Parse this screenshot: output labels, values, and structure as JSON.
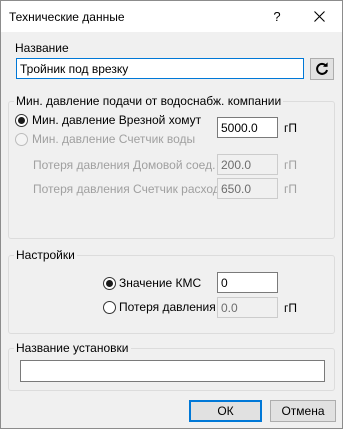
{
  "window": {
    "title": "Технические данные",
    "help_label": "?"
  },
  "name_section": {
    "label": "Название",
    "value": "Тройник под врезку"
  },
  "pressure_group": {
    "title": "Мин. давление подачи от водоснабж. компании",
    "option1_label": "Мин. давление Врезной хомут",
    "option1_value": "5000.0",
    "option1_unit": "гП",
    "option2_label": "Мин. давление Счетчик воды",
    "loss_home_label": "Потеря давления Домовой соед.",
    "loss_home_value": "200.0",
    "loss_home_unit": "гП",
    "loss_meter_label": "Потеря давления Счетчик расхода",
    "loss_meter_value": "650.0",
    "loss_meter_unit": "гП"
  },
  "settings_group": {
    "title": "Настройки",
    "kms_label": "Значение КМС",
    "kms_value": "0",
    "loss_label": "Потеря давления",
    "loss_value": "0.0",
    "loss_unit": "гП"
  },
  "install_group": {
    "title": "Название установки",
    "value": ""
  },
  "buttons": {
    "ok": "ОК",
    "cancel": "Отмена"
  },
  "icons": {
    "refresh": "refresh-icon",
    "close": "close-icon"
  }
}
